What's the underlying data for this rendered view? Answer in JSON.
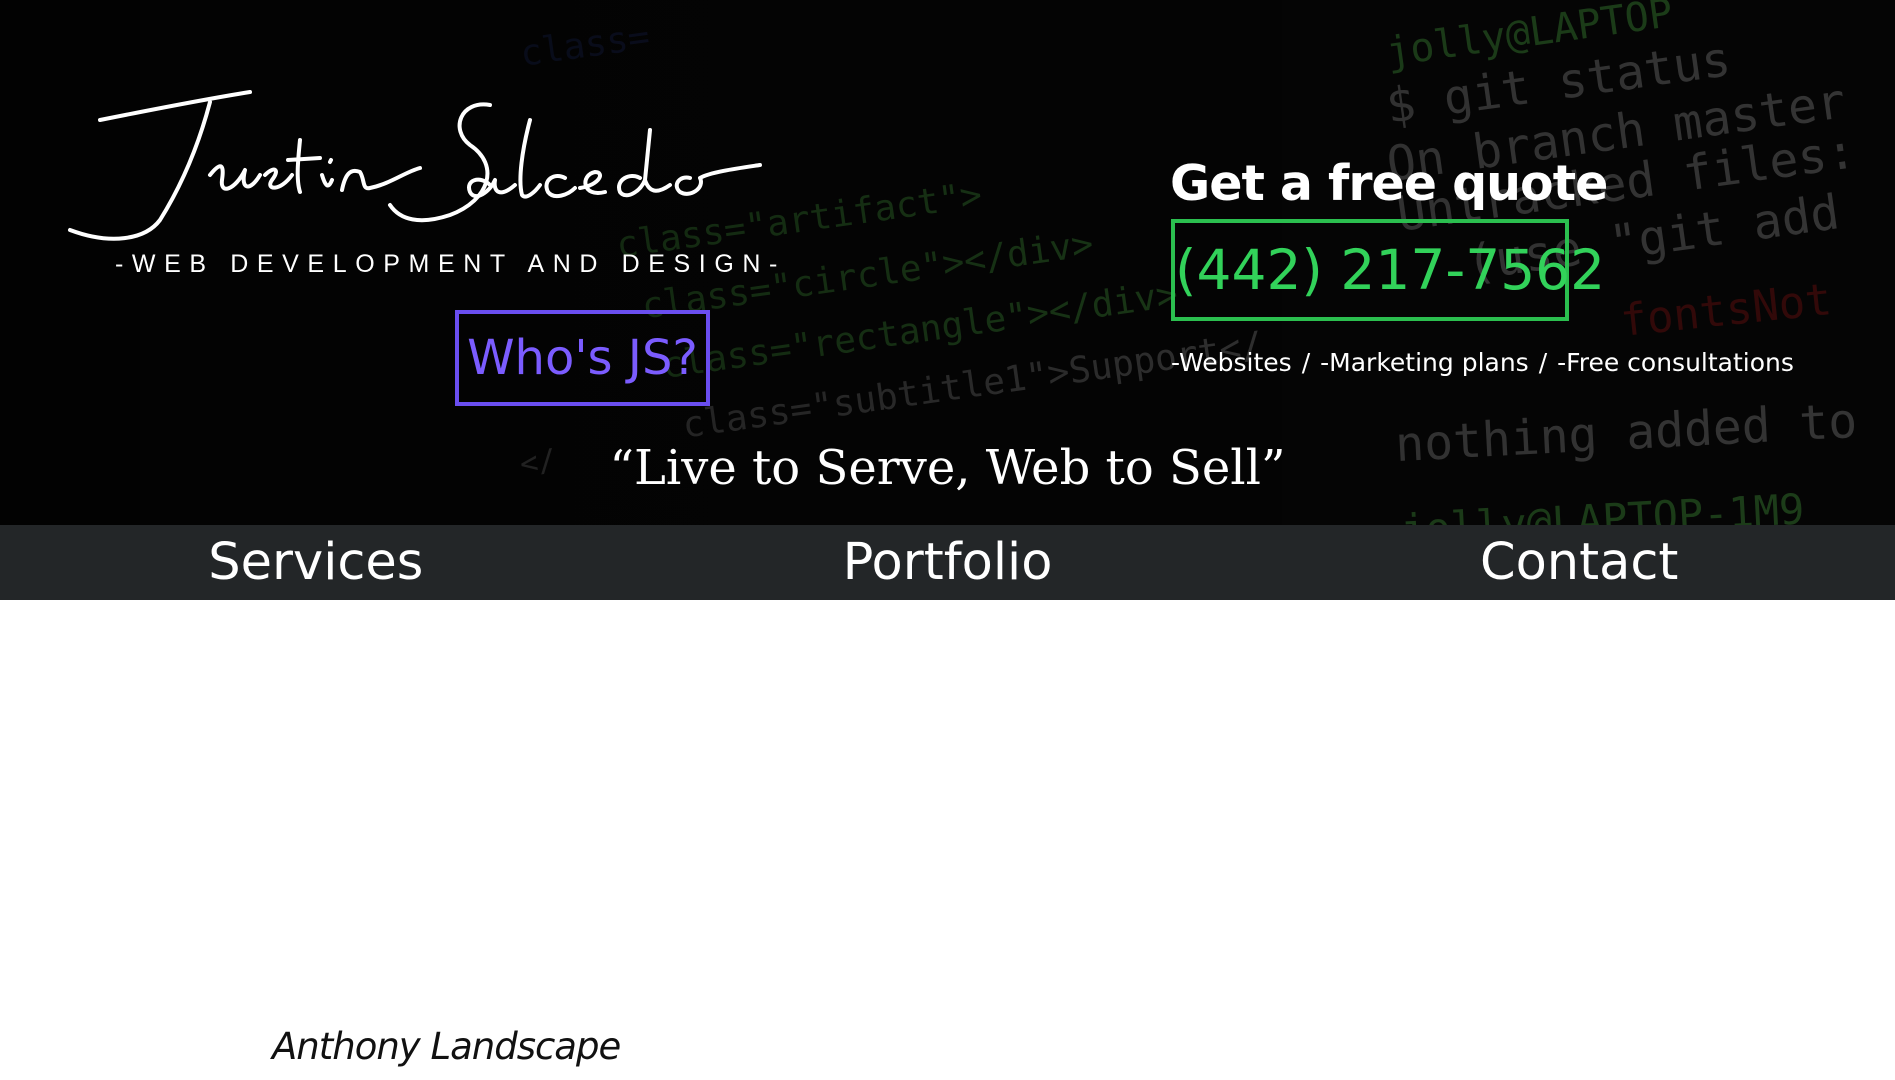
{
  "header": {
    "signature_name": "Justin Salcedo",
    "tagline": "-WEB DEVELOPMENT AND DESIGN-",
    "whos_js_button": "Who's JS?",
    "quote_title": "Get a free quote",
    "phone": "(442) 217-7562",
    "services": [
      "-Websites",
      "-Marketing plans",
      "-Free consultations"
    ],
    "services_separator": "/",
    "motto": "“Live to Serve, Web to Sell”"
  },
  "nav": {
    "items": [
      "Services",
      "Portfolio",
      "Contact"
    ]
  },
  "portfolio": {
    "first_project": "Anthony Landscape"
  },
  "colors": {
    "hero_background": "#050505",
    "nav_background": "#232628",
    "whos_js_accent": "#6a4ef0",
    "phone_accent": "#2bbf4f",
    "text_light": "#ffffff"
  }
}
